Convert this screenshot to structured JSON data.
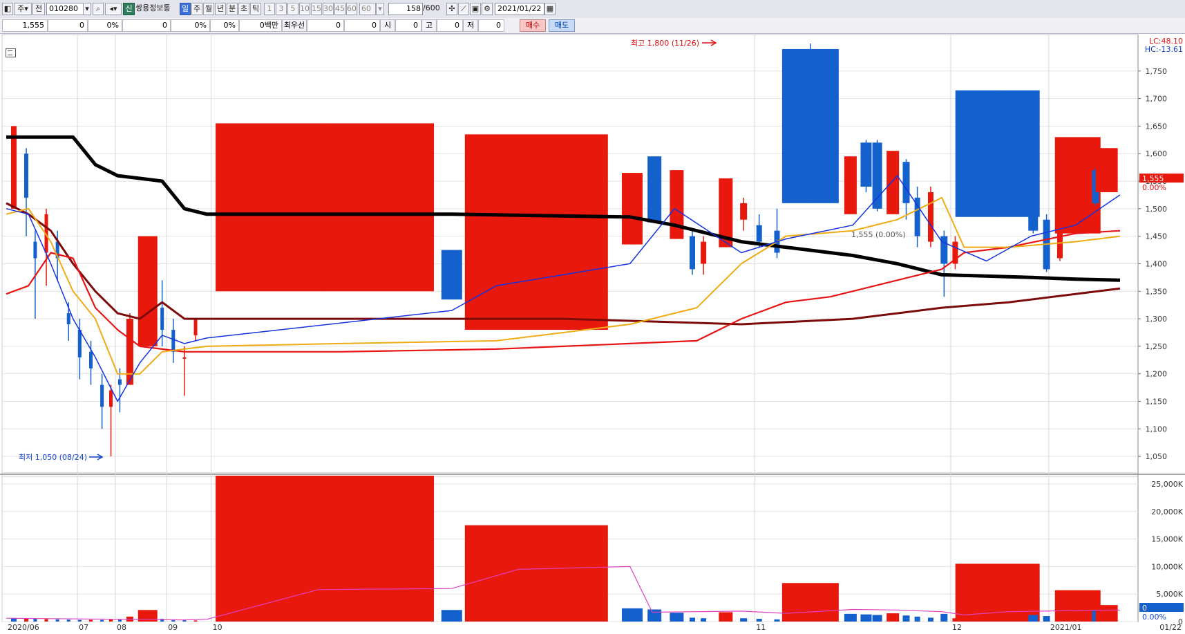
{
  "toolbar": {
    "period_select": "주",
    "jeon_label": "전",
    "code": "010280",
    "stock_name": "쌍용정보통",
    "shin_badge": "신",
    "period_tabs": [
      "일",
      "주",
      "월",
      "년",
      "분",
      "초",
      "틱"
    ],
    "active_period": "일",
    "num_buttons": [
      "1",
      "3",
      "5",
      "10",
      "15",
      "30",
      "45",
      "60"
    ],
    "num_select": "60",
    "count": "158",
    "count_total": "/600",
    "date": "2021/01/22"
  },
  "quote_bar": {
    "price": "1,555",
    "change": "0",
    "rate": "0%",
    "volume": "0",
    "v_rate": "0%",
    "v_rate2": "0%",
    "amount": "0백만",
    "best_label": "최우선",
    "best_val1": "0",
    "best_val2": "0",
    "open_label": "시",
    "open_val": "0",
    "high_label": "고",
    "high_val": "0",
    "low_label": "저",
    "low_val": "0",
    "buy_label": "매수",
    "sell_label": "매도"
  },
  "colors": {
    "up": "#e8190c",
    "down": "#1460cc",
    "ma5": "#1432e0",
    "ma20": "#f0aa14",
    "ma60": "#e81414",
    "ma120": "#7d0a0a",
    "ma240": "#000000",
    "vol_ma": "#e040c0"
  },
  "chart_data": {
    "type": "candlestick",
    "x_ticks": [
      "2020/06",
      "07",
      "08",
      "09",
      "10",
      "11",
      "12",
      "2021/01",
      "01/22"
    ],
    "y_ticks": [
      "1,750",
      "1,700",
      "1,650",
      "1,600",
      "1,550",
      "1,500",
      "1,450",
      "1,400",
      "1,350",
      "1,300",
      "1,250",
      "1,200",
      "1,150",
      "1,100",
      "1,050"
    ],
    "ylim": [
      1020,
      1810
    ],
    "volume_ticks": [
      "25,000K",
      "20,000K",
      "15,000K",
      "10,000K",
      "5,000K",
      "0"
    ],
    "volume_ylim": [
      0,
      26500
    ],
    "annotations": {
      "high": "최고 1,800 (11/26)",
      "low": "최저 1,050 (08/24)",
      "prev_close": "1,555 (0.00%)"
    },
    "right_labels": {
      "lc": "LC:48.10",
      "hc": "HC:-13.61",
      "current_price": "1,555",
      "current_rate": "0.00%",
      "current_volume": "0",
      "current_volume_rate": "0.00%"
    },
    "candles": [
      {
        "x": 0.34,
        "o": 1500,
        "c": 1650,
        "h": 1650,
        "l": 1500
      },
      {
        "x": 0.9,
        "o": 1600,
        "c": 1520,
        "h": 1610,
        "l": 1450
      },
      {
        "x": 1.3,
        "o": 1440,
        "c": 1410,
        "h": 1460,
        "l": 1300
      },
      {
        "x": 1.8,
        "o": 1420,
        "c": 1490,
        "h": 1500,
        "l": 1360
      },
      {
        "x": 2.3,
        "o": 1440,
        "c": 1410,
        "h": 1460,
        "l": 1370
      },
      {
        "x": 2.8,
        "o": 1310,
        "c": 1290,
        "h": 1330,
        "l": 1260
      },
      {
        "x": 3.3,
        "o": 1280,
        "c": 1230,
        "h": 1300,
        "l": 1190
      },
      {
        "x": 3.8,
        "o": 1240,
        "c": 1210,
        "h": 1260,
        "l": 1180
      },
      {
        "x": 4.3,
        "o": 1180,
        "c": 1140,
        "h": 1200,
        "l": 1100
      },
      {
        "x": 4.7,
        "o": 1140,
        "c": 1170,
        "h": 1180,
        "l": 1050
      },
      {
        "x": 5.1,
        "o": 1190,
        "c": 1180,
        "h": 1210,
        "l": 1130
      },
      {
        "x": 5.55,
        "o": 1180,
        "c": 1300,
        "h": 1310,
        "l": 1180
      },
      {
        "x": 6.35,
        "o": 1250,
        "c": 1450,
        "h": 1450,
        "l": 1250
      },
      {
        "x": 7.0,
        "o": 1320,
        "c": 1280,
        "h": 1370,
        "l": 1250
      },
      {
        "x": 7.5,
        "o": 1280,
        "c": 1240,
        "h": 1300,
        "l": 1220
      },
      {
        "x": 8.0,
        "o": 1230,
        "c": 1230,
        "h": 1250,
        "l": 1160
      },
      {
        "x": 8.5,
        "o": 1270,
        "c": 1300,
        "h": 1300,
        "l": 1260
      },
      {
        "x": 14.3,
        "o": 1350,
        "c": 1655,
        "h": 1655,
        "l": 1350
      },
      {
        "x": 20.0,
        "o": 1425,
        "c": 1335,
        "h": 1425,
        "l": 1335
      },
      {
        "x": 23.8,
        "o": 1280,
        "c": 1635,
        "h": 1635,
        "l": 1280
      },
      {
        "x": 28.1,
        "o": 1435,
        "c": 1565,
        "h": 1565,
        "l": 1435
      },
      {
        "x": 29.1,
        "o": 1595,
        "c": 1475,
        "h": 1595,
        "l": 1475
      },
      {
        "x": 30.1,
        "o": 1445,
        "c": 1570,
        "h": 1570,
        "l": 1445
      },
      {
        "x": 30.8,
        "o": 1450,
        "c": 1390,
        "h": 1460,
        "l": 1380
      },
      {
        "x": 31.3,
        "o": 1400,
        "c": 1440,
        "h": 1450,
        "l": 1380
      },
      {
        "x": 32.3,
        "o": 1430,
        "c": 1555,
        "h": 1555,
        "l": 1430
      },
      {
        "x": 33.1,
        "o": 1480,
        "c": 1510,
        "h": 1520,
        "l": 1460
      },
      {
        "x": 33.8,
        "o": 1470,
        "c": 1440,
        "h": 1490,
        "l": 1430
      },
      {
        "x": 34.6,
        "o": 1460,
        "c": 1420,
        "h": 1500,
        "l": 1410
      },
      {
        "x": 36.1,
        "o": 1790,
        "c": 1510,
        "h": 1800,
        "l": 1510
      },
      {
        "x": 37.9,
        "o": 1490,
        "c": 1595,
        "h": 1595,
        "l": 1490
      },
      {
        "x": 38.6,
        "o": 1620,
        "c": 1540,
        "h": 1625,
        "l": 1530
      },
      {
        "x": 39.1,
        "o": 1620,
        "c": 1500,
        "h": 1625,
        "l": 1495
      },
      {
        "x": 39.8,
        "o": 1490,
        "c": 1605,
        "h": 1605,
        "l": 1490
      },
      {
        "x": 40.4,
        "o": 1585,
        "c": 1510,
        "h": 1590,
        "l": 1480
      },
      {
        "x": 40.9,
        "o": 1520,
        "c": 1450,
        "h": 1540,
        "l": 1430
      },
      {
        "x": 41.5,
        "o": 1440,
        "c": 1530,
        "h": 1540,
        "l": 1430
      },
      {
        "x": 42.1,
        "o": 1450,
        "c": 1400,
        "h": 1460,
        "l": 1340
      },
      {
        "x": 42.6,
        "o": 1400,
        "c": 1440,
        "h": 1450,
        "l": 1390
      },
      {
        "x": 44.5,
        "o": 1715,
        "c": 1485,
        "h": 1715,
        "l": 1485
      },
      {
        "x": 46.1,
        "o": 1520,
        "c": 1460,
        "h": 1525,
        "l": 1455
      },
      {
        "x": 46.7,
        "o": 1480,
        "c": 1390,
        "h": 1490,
        "l": 1385
      },
      {
        "x": 47.3,
        "o": 1410,
        "c": 1490,
        "h": 1490,
        "l": 1405
      },
      {
        "x": 48.1,
        "o": 1455,
        "c": 1630,
        "h": 1630,
        "l": 1455
      },
      {
        "x": 48.9,
        "o": 1570,
        "c": 1510,
        "h": 1575,
        "l": 1505
      },
      {
        "x": 49.4,
        "o": 1530,
        "c": 1610,
        "h": 1610,
        "l": 1530
      }
    ],
    "volume_bars": [
      {
        "x": 0.34,
        "v": 650,
        "up": false
      },
      {
        "x": 0.9,
        "v": 550,
        "up": true
      },
      {
        "x": 1.3,
        "v": 500,
        "up": false
      },
      {
        "x": 1.8,
        "v": 450,
        "up": true
      },
      {
        "x": 2.3,
        "v": 400,
        "up": false
      },
      {
        "x": 2.8,
        "v": 350,
        "up": false
      },
      {
        "x": 3.3,
        "v": 300,
        "up": false
      },
      {
        "x": 3.8,
        "v": 320,
        "up": true
      },
      {
        "x": 4.3,
        "v": 300,
        "up": false
      },
      {
        "x": 4.7,
        "v": 380,
        "up": true
      },
      {
        "x": 5.1,
        "v": 350,
        "up": false
      },
      {
        "x": 5.55,
        "v": 900,
        "up": true
      },
      {
        "x": 6.35,
        "v": 2100,
        "up": true
      },
      {
        "x": 7.0,
        "v": 500,
        "up": false
      },
      {
        "x": 7.5,
        "v": 300,
        "up": false
      },
      {
        "x": 8.0,
        "v": 250,
        "up": false
      },
      {
        "x": 8.5,
        "v": 200,
        "up": true
      },
      {
        "x": 14.3,
        "v": 26500,
        "up": true
      },
      {
        "x": 20.0,
        "v": 2100,
        "up": false
      },
      {
        "x": 23.8,
        "v": 17500,
        "up": true
      },
      {
        "x": 28.1,
        "v": 2400,
        "up": false
      },
      {
        "x": 29.1,
        "v": 2200,
        "up": false
      },
      {
        "x": 30.1,
        "v": 1600,
        "up": false
      },
      {
        "x": 30.8,
        "v": 700,
        "up": false
      },
      {
        "x": 31.3,
        "v": 600,
        "up": false
      },
      {
        "x": 32.3,
        "v": 1700,
        "up": true
      },
      {
        "x": 33.1,
        "v": 600,
        "up": false
      },
      {
        "x": 33.8,
        "v": 500,
        "up": false
      },
      {
        "x": 34.6,
        "v": 400,
        "up": false
      },
      {
        "x": 36.1,
        "v": 7000,
        "up": true
      },
      {
        "x": 37.9,
        "v": 1400,
        "up": false
      },
      {
        "x": 38.6,
        "v": 1300,
        "up": false
      },
      {
        "x": 39.1,
        "v": 1200,
        "up": false
      },
      {
        "x": 39.8,
        "v": 1500,
        "up": true
      },
      {
        "x": 40.4,
        "v": 1100,
        "up": false
      },
      {
        "x": 40.9,
        "v": 900,
        "up": false
      },
      {
        "x": 41.5,
        "v": 700,
        "up": false
      },
      {
        "x": 42.1,
        "v": 1400,
        "up": false
      },
      {
        "x": 42.6,
        "v": 600,
        "up": true
      },
      {
        "x": 44.5,
        "v": 10500,
        "up": true
      },
      {
        "x": 46.1,
        "v": 1200,
        "up": false
      },
      {
        "x": 46.7,
        "v": 1000,
        "up": false
      },
      {
        "x": 47.3,
        "v": 800,
        "up": false
      },
      {
        "x": 48.1,
        "v": 5700,
        "up": true
      },
      {
        "x": 48.9,
        "v": 2000,
        "up": false
      },
      {
        "x": 49.4,
        "v": 3000,
        "up": true
      }
    ],
    "ma5": [
      [
        0,
        1500
      ],
      [
        1,
        1490
      ],
      [
        2,
        1400
      ],
      [
        3,
        1300
      ],
      [
        4,
        1230
      ],
      [
        5,
        1150
      ],
      [
        6,
        1220
      ],
      [
        7,
        1270
      ],
      [
        8,
        1255
      ],
      [
        9,
        1265
      ],
      [
        20,
        1315
      ],
      [
        22,
        1360
      ],
      [
        25,
        1380
      ],
      [
        28,
        1400
      ],
      [
        30,
        1500
      ],
      [
        33,
        1420
      ],
      [
        35,
        1445
      ],
      [
        38,
        1470
      ],
      [
        40,
        1560
      ],
      [
        42,
        1440
      ],
      [
        44,
        1405
      ],
      [
        46,
        1450
      ],
      [
        48,
        1470
      ],
      [
        50,
        1525
      ]
    ],
    "ma20": [
      [
        0,
        1490
      ],
      [
        1,
        1500
      ],
      [
        2,
        1440
      ],
      [
        3,
        1350
      ],
      [
        4,
        1300
      ],
      [
        5,
        1200
      ],
      [
        6,
        1200
      ],
      [
        7,
        1240
      ],
      [
        8,
        1245
      ],
      [
        9,
        1250
      ],
      [
        15,
        1255
      ],
      [
        22,
        1260
      ],
      [
        25,
        1275
      ],
      [
        28,
        1290
      ],
      [
        31,
        1320
      ],
      [
        33,
        1400
      ],
      [
        35,
        1450
      ],
      [
        38,
        1460
      ],
      [
        40,
        1480
      ],
      [
        42,
        1520
      ],
      [
        43,
        1430
      ],
      [
        45,
        1430
      ],
      [
        48,
        1440
      ],
      [
        50,
        1450
      ]
    ],
    "ma60": [
      [
        0,
        1345
      ],
      [
        1,
        1360
      ],
      [
        2,
        1420
      ],
      [
        3,
        1410
      ],
      [
        4,
        1320
      ],
      [
        5,
        1280
      ],
      [
        6,
        1250
      ],
      [
        7,
        1245
      ],
      [
        8,
        1240
      ],
      [
        9,
        1240
      ],
      [
        15,
        1240
      ],
      [
        22,
        1245
      ],
      [
        25,
        1250
      ],
      [
        28,
        1255
      ],
      [
        31,
        1260
      ],
      [
        33,
        1300
      ],
      [
        35,
        1330
      ],
      [
        37,
        1340
      ],
      [
        40,
        1370
      ],
      [
        42,
        1390
      ],
      [
        43,
        1420
      ],
      [
        45,
        1430
      ],
      [
        48,
        1455
      ],
      [
        50,
        1460
      ]
    ],
    "ma120": [
      [
        0,
        1510
      ],
      [
        1,
        1490
      ],
      [
        2,
        1460
      ],
      [
        3,
        1400
      ],
      [
        4,
        1350
      ],
      [
        5,
        1310
      ],
      [
        6,
        1300
      ],
      [
        7,
        1330
      ],
      [
        8,
        1300
      ],
      [
        9,
        1300
      ],
      [
        20,
        1300
      ],
      [
        25,
        1300
      ],
      [
        29,
        1295
      ],
      [
        33,
        1290
      ],
      [
        38,
        1300
      ],
      [
        40,
        1310
      ],
      [
        42,
        1320
      ],
      [
        45,
        1330
      ],
      [
        48,
        1345
      ],
      [
        50,
        1355
      ]
    ],
    "ma240": [
      [
        0,
        1630
      ],
      [
        2,
        1630
      ],
      [
        3,
        1630
      ],
      [
        4,
        1580
      ],
      [
        5,
        1560
      ],
      [
        6,
        1555
      ],
      [
        7,
        1550
      ],
      [
        8,
        1500
      ],
      [
        9,
        1490
      ],
      [
        20,
        1490
      ],
      [
        28,
        1485
      ],
      [
        30,
        1470
      ],
      [
        33,
        1440
      ],
      [
        35,
        1430
      ],
      [
        38,
        1415
      ],
      [
        40,
        1400
      ],
      [
        42,
        1380
      ],
      [
        46,
        1375
      ],
      [
        48,
        1372
      ],
      [
        50,
        1370
      ]
    ],
    "vol_ma": [
      [
        0,
        600
      ],
      [
        8,
        300
      ],
      [
        9,
        400
      ],
      [
        14,
        5800
      ],
      [
        20,
        6000
      ],
      [
        23,
        9500
      ],
      [
        28,
        10000
      ],
      [
        29,
        1700
      ],
      [
        31,
        1800
      ],
      [
        33,
        1900
      ],
      [
        35,
        1500
      ],
      [
        38,
        2200
      ],
      [
        40,
        2100
      ],
      [
        42,
        1800
      ],
      [
        43,
        1200
      ],
      [
        45,
        1800
      ],
      [
        48,
        2000
      ],
      [
        50,
        2100
      ]
    ]
  }
}
